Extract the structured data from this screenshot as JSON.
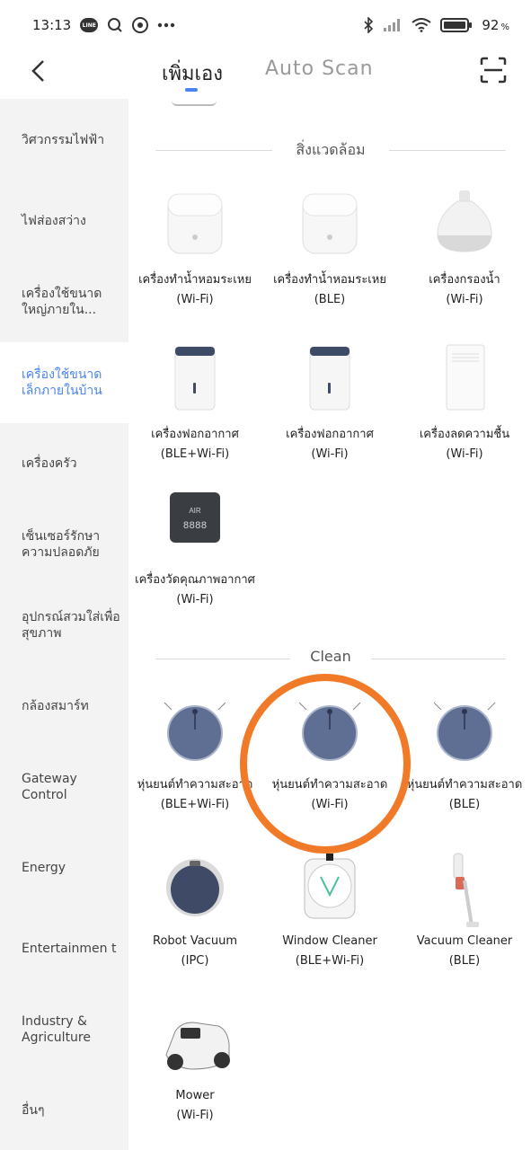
{
  "status_bar": {
    "time": "13:13",
    "line_badge": "LINE",
    "battery": "92",
    "battery_unit": "%",
    "icons": [
      "line-icon",
      "search-icon",
      "chrome-icon",
      "more-dots-icon",
      "bluetooth-icon",
      "signal-icon",
      "wifi-icon",
      "battery-icon"
    ]
  },
  "header": {
    "tab_manual": "เพิ่มเอง",
    "tab_auto": "Auto Scan"
  },
  "sidebar": {
    "active_index": 3,
    "items": [
      {
        "label": "วิศวกรรมไฟฟ้า"
      },
      {
        "label": "ไฟส่องสว่าง"
      },
      {
        "label": "เครื่องใช้ขนาดใหญ่ภายใน..."
      },
      {
        "label": "เครื่องใช้ขนาดเล็กภายในบ้าน"
      },
      {
        "label": "เครื่องครัว"
      },
      {
        "label": "เซ็นเซอร์รักษาความปลอดภัย"
      },
      {
        "label": "อุปกรณ์สวมใส่เพื่อสุขภาพ"
      },
      {
        "label": "กล้องสมาร์ท"
      },
      {
        "label": "Gateway Control"
      },
      {
        "label": "Energy"
      },
      {
        "label": "Entertainmen t"
      },
      {
        "label": "Industry & Agriculture"
      },
      {
        "label": "อื่นๆ"
      }
    ]
  },
  "sections": {
    "environment": "สิ่งแวดล้อม",
    "clean": "Clean"
  },
  "devices": {
    "environment": [
      {
        "name": "เครื่องทำน้ำหอมระเหย",
        "conn": "(Wi-Fi)",
        "icon": "aroma-diffuser-icon"
      },
      {
        "name": "เครื่องทำน้ำหอมระเหย",
        "conn": "(BLE)",
        "icon": "aroma-diffuser-icon"
      },
      {
        "name": "เครื่องกรองน้ำ",
        "conn": "(Wi-Fi)",
        "icon": "water-purifier-icon"
      },
      {
        "name": "เครื่องฟอกอากาศ",
        "conn": "(BLE+Wi-Fi)",
        "icon": "air-purifier-icon"
      },
      {
        "name": "เครื่องฟอกอากาศ",
        "conn": "(Wi-Fi)",
        "icon": "air-purifier-icon"
      },
      {
        "name": "เครื่องลดความชื้น",
        "conn": "(Wi-Fi)",
        "icon": "dehumidifier-icon"
      },
      {
        "name": "เครื่องวัดคุณภาพอากาศ",
        "conn": "(Wi-Fi)",
        "icon": "air-quality-monitor-icon",
        "screen_text": "AIR",
        "screen_digits": "8888"
      }
    ],
    "clean": [
      {
        "name": "หุ่นยนต์ทำความสะอาด",
        "conn": "(BLE+Wi-Fi)",
        "icon": "robot-cleaner-icon"
      },
      {
        "name": "หุ่นยนต์ทำความสะอาด",
        "conn": "(Wi-Fi)",
        "icon": "robot-cleaner-icon"
      },
      {
        "name": "หุ่นยนต์ทำความสะอาด",
        "conn": "(BLE)",
        "icon": "robot-cleaner-icon"
      },
      {
        "name": "Robot Vacuum",
        "conn": "(IPC)",
        "icon": "robot-vacuum-camera-icon"
      },
      {
        "name": "Window Cleaner",
        "conn": "(BLE+Wi-Fi)",
        "icon": "window-cleaner-icon"
      },
      {
        "name": "Vacuum Cleaner",
        "conn": "(BLE)",
        "icon": "stick-vacuum-icon"
      },
      {
        "name": "Mower",
        "conn": "(Wi-Fi)",
        "icon": "robot-mower-icon"
      }
    ]
  },
  "colors": {
    "accent": "#4a84f0",
    "highlight_ring": "#f07a28",
    "sidebar_bg": "#f3f3f3"
  }
}
